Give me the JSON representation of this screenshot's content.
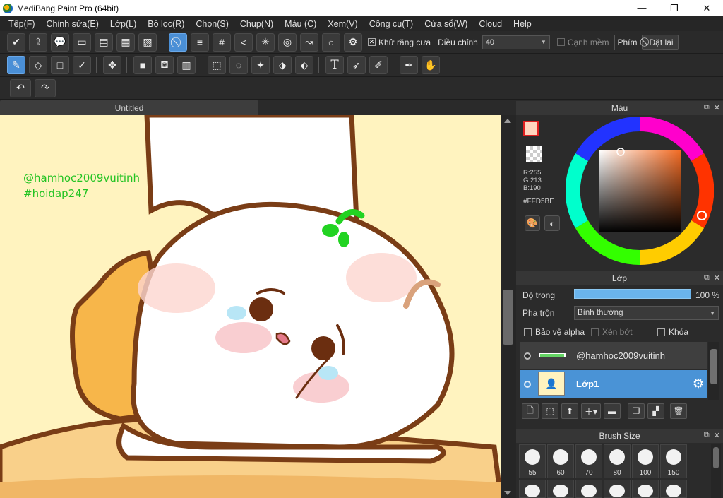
{
  "window": {
    "title": "MediBang Paint Pro (64bit)",
    "minimize": "—",
    "maximize": "❐",
    "close": "✕"
  },
  "menu": [
    "Tệp(F)",
    "Chỉnh sửa(E)",
    "Lớp(L)",
    "Bộ lọc(R)",
    "Chọn(S)",
    "Chụp(N)",
    "Màu (C)",
    "Xem(V)",
    "Công cụ(T)",
    "Cửa sổ(W)",
    "Cloud",
    "Help"
  ],
  "toolbar1": {
    "antialias_label": "Khử răng cưa",
    "correction_label": "Điều chỉnh",
    "correction_value": "40",
    "soft_edge_label": "Cạnh mềm",
    "key_label": "Phím",
    "reset_label": "Đặt lại"
  },
  "document": {
    "tab_title": "Untitled",
    "watermark_line1": "@hamhoc2009vuitinh",
    "watermark_line2": "#hoidap247",
    "background_color": "#fff3bf"
  },
  "color_panel": {
    "title": "Màu",
    "r": "R:255",
    "g": "G:213",
    "b": "B:190",
    "hex": "#FFD5BE",
    "primary_color": "#ffd5be"
  },
  "layer_panel": {
    "title": "Lớp",
    "opacity_label": "Độ trong",
    "opacity_value": "100 %",
    "opacity_fraction": 1.0,
    "blend_label": "Pha trộn",
    "blend_value": "Bình thường",
    "protect_alpha": "Bảo vệ alpha",
    "clipping": "Xén bớt",
    "lock": "Khóa",
    "layers": [
      {
        "name": "@hamhoc2009vuitinh",
        "selected": false
      },
      {
        "name": "Lớp1",
        "selected": true
      }
    ]
  },
  "brush_panel": {
    "title": "Brush Size",
    "sizes": [
      "55",
      "60",
      "70",
      "80",
      "100",
      "150"
    ]
  }
}
